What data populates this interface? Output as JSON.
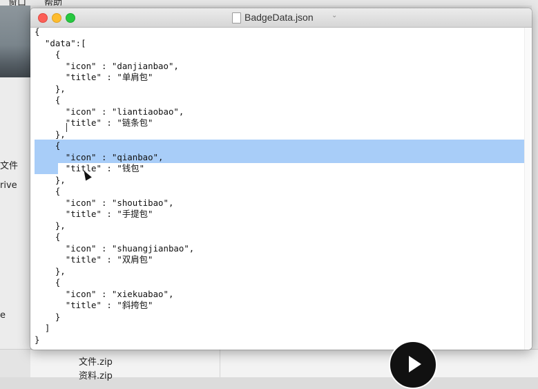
{
  "menubar": {
    "item1": "窗口",
    "item2": "帮助"
  },
  "window": {
    "title": "BadgeData.json"
  },
  "finder": {
    "sidebar_label_1": "文件",
    "sidebar_label_2": "rive",
    "sidebar_label_3": "e",
    "file_1": "文件.zip",
    "file_2": "资料.zip"
  },
  "code_lines": [
    "{",
    "  \"data\":[",
    "    {",
    "      \"icon\" : \"danjianbao\",",
    "      \"title\" : \"单肩包\"",
    "    },",
    "    {",
    "      \"icon\" : \"liantiaobao\",",
    "      \"title\" : \"链条包\"",
    "    },",
    "    {",
    "      \"icon\" : \"qianbao\",",
    "      \"title\" : \"钱包\"",
    "    },",
    "    {",
    "      \"icon\" : \"shoutibao\",",
    "      \"title\" : \"手提包\"",
    "    },",
    "    {",
    "      \"icon\" : \"shuangjianbao\",",
    "      \"title\" : \"双肩包\"",
    "    },",
    "    {",
    "      \"icon\" : \"xiekuabao\",",
    "      \"title\" : \"斜挎包\"",
    "    }",
    "  ]",
    "}"
  ],
  "player": {
    "icon": "play-icon"
  }
}
